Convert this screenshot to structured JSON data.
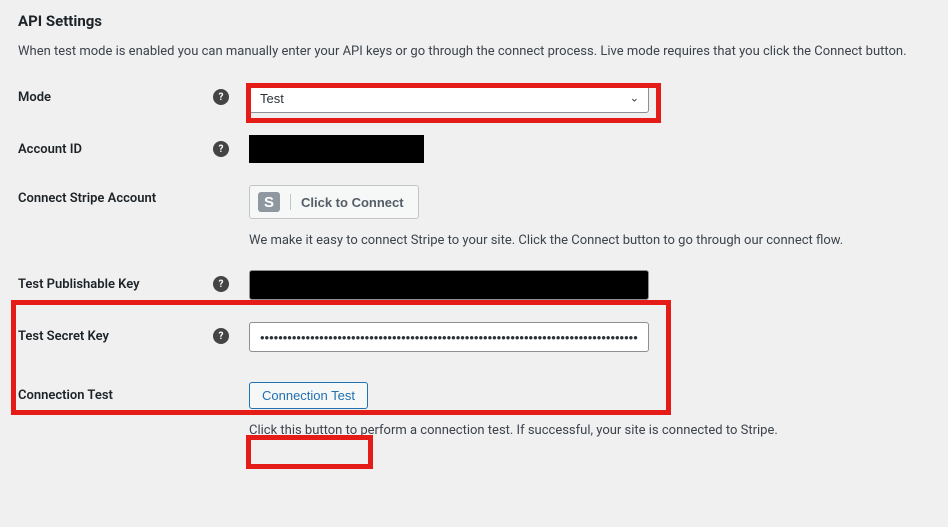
{
  "heading": "API Settings",
  "intro": "When test mode is enabled you can manually enter your API keys or go through the connect process. Live mode requires that you click the Connect button.",
  "mode": {
    "label": "Mode",
    "value": "Test"
  },
  "account": {
    "label": "Account ID"
  },
  "connect": {
    "label": "Connect Stripe Account",
    "button": "Click to Connect",
    "desc": "We make it easy to connect Stripe to your site. Click the Connect button to go through our connect flow."
  },
  "pubkey": {
    "label": "Test Publishable Key"
  },
  "secret": {
    "label": "Test Secret Key",
    "value": "••••••••••••••••••••••••••••••••••••••••••••••••••••••••••••••••••••••••••••••••••••••••••••••••••••••••"
  },
  "conntest": {
    "label": "Connection Test",
    "button": "Connection Test",
    "desc": "Click this button to perform a connection test. If successful, your site is connected to Stripe."
  }
}
